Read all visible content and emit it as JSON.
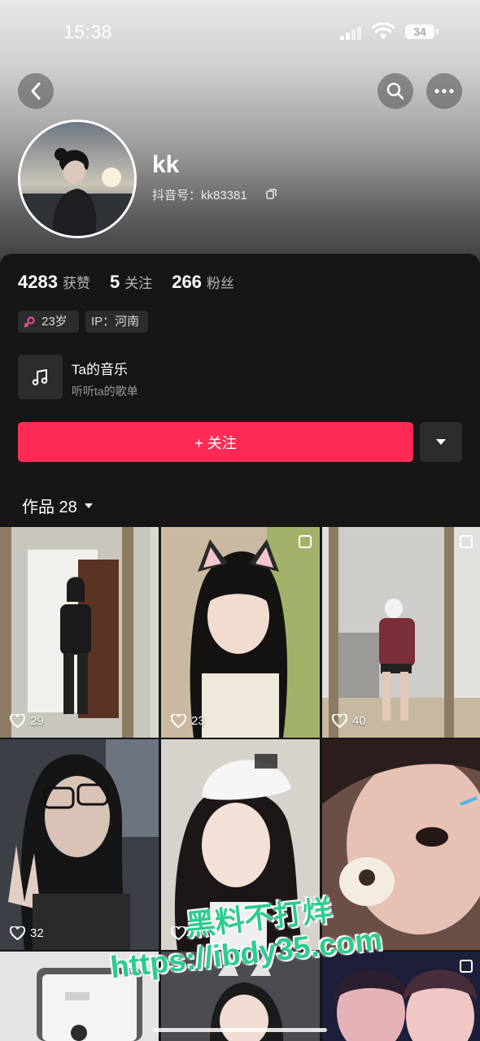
{
  "status_bar": {
    "time": "15:38",
    "battery": "34"
  },
  "profile": {
    "username": "kk",
    "douyin_id": "抖音号：kk83381"
  },
  "stats": [
    {
      "num": "4283",
      "label": "获赞"
    },
    {
      "num": "5",
      "label": "关注"
    },
    {
      "num": "266",
      "label": "粉丝"
    }
  ],
  "tags": {
    "age": "23岁",
    "ip": "IP：河南"
  },
  "music": {
    "title": "Ta的音乐",
    "subtitle": "听听ta的歌单"
  },
  "follow_label": "+ 关注",
  "works_tab": "作品 28",
  "videos": [
    {
      "likes": "29"
    },
    {
      "likes": "23"
    },
    {
      "likes": "40"
    },
    {
      "likes": "32"
    },
    {
      "likes": ""
    },
    {
      "likes": ""
    },
    {
      "likes": ""
    },
    {
      "likes": ""
    },
    {
      "likes": ""
    }
  ],
  "watermark": {
    "line1": "黑料不打烊",
    "line2": "https://ibdy35.com"
  },
  "colors": {
    "accent": "#fe2c55",
    "panel": "#161616",
    "tag_bg": "#2c2c2c",
    "watermark": "#2ecc8f"
  }
}
